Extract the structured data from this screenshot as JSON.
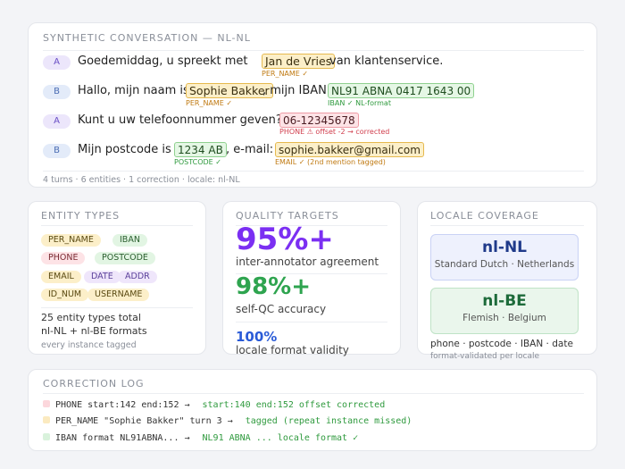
{
  "conversation": {
    "title": "SYNTHETIC CONVERSATION — nl-NL",
    "turns": [
      {
        "speaker": "A",
        "pre": "Goedemiddag, u spreekt met",
        "ent1": "Jan de Vries",
        "tag1": "PER_NAME ✓",
        "post": "van klantenservice."
      },
      {
        "speaker": "B",
        "pre": "Hallo, mijn naam is",
        "ent1": "Sophie Bakker",
        "tag1": "PER_NAME ✓",
        "mid": ", mijn IBAN",
        "ent2": "NL91 ABNA 0417 1643 00",
        "tag2": "IBAN ✓ NL-format"
      },
      {
        "speaker": "A",
        "pre": "Kunt u uw telefoonnummer geven?",
        "ent1": "06-12345678",
        "tag1": "PHONE ⚠ offset -2 → corrected"
      },
      {
        "speaker": "B",
        "pre": "Mijn postcode is",
        "ent1": "1234 AB",
        "tag1": "POSTCODE ✓",
        "mid": ", e-mail:",
        "ent2": "sophie.bakker@gmail.com",
        "tag2": "EMAIL ✓ (2nd mention tagged)"
      }
    ],
    "footer": "4 turns · 6 entities · 1 correction · locale: nl-NL"
  },
  "entity_types": {
    "title": "ENTITY TYPES",
    "pills": [
      "PER_NAME",
      "IBAN",
      "PHONE",
      "POSTCODE",
      "EMAIL",
      "DATE",
      "ADDR",
      "ID_NUM",
      "USERNAME"
    ],
    "line1": "25 entity types total",
    "line2": "nl-NL + nl-BE formats",
    "sub": "every instance tagged"
  },
  "quality": {
    "title": "QUALITY TARGETS",
    "metrics": [
      {
        "value": "95%+",
        "label": "inter-annotator agreement"
      },
      {
        "value": "98%+",
        "label": "self-QC accuracy"
      },
      {
        "value": "100%",
        "label": "locale format validity"
      }
    ]
  },
  "locale": {
    "title": "LOCALE COVERAGE",
    "locales": [
      {
        "code": "nl-NL",
        "desc": "Standard Dutch · Netherlands"
      },
      {
        "code": "nl-BE",
        "desc": "Flemish · Belgium"
      }
    ],
    "line": "phone · postcode · IBAN · date",
    "sub": "format-validated per locale"
  },
  "log": {
    "title": "CORRECTION LOG",
    "rows": [
      {
        "left": "PHONE start:142 end:152 →",
        "right": "start:140 end:152 offset corrected"
      },
      {
        "left": "PER_NAME \"Sophie Bakker\" turn 3 →",
        "right": "tagged (repeat instance missed)"
      },
      {
        "left": "IBAN format NL91ABNA... →",
        "right": "NL91 ABNA ... locale format ✓"
      }
    ]
  },
  "colors": {
    "purple": "#7b2ff2",
    "green": "#2ea44f",
    "blue": "#2a5bd7",
    "navy": "#1f3a8a",
    "teal": "#1d6b3a"
  }
}
